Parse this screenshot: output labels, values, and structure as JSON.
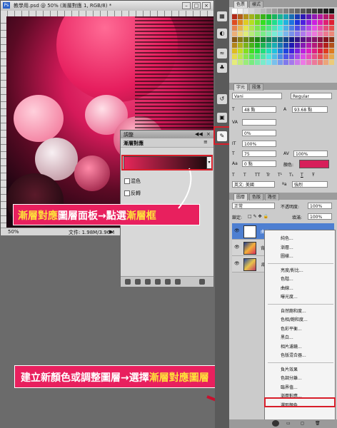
{
  "document": {
    "title": "教學用.psd @ 50% (漸層對應 1, RGB/8) *",
    "zoom": "50%",
    "file_info": "文件: 1.98M/3.96M"
  },
  "adjustments_panel": {
    "tab": "調整",
    "title": "漸層對應",
    "options": [
      "混色",
      "反轉"
    ]
  },
  "callouts": {
    "top_parts": [
      "漸層對應",
      "圖層面板→點選",
      "漸層框"
    ],
    "bottom_parts": [
      "建立新顏色或調整圖層→選擇",
      "漸層對應圖層"
    ]
  },
  "swatches_panel": {
    "tabs": [
      "色票",
      "樣式"
    ]
  },
  "character_panel": {
    "tabs": [
      "字元",
      "段落"
    ],
    "font_family": "Vani",
    "font_style": "Regular",
    "font_size": "48 點",
    "leading": "93.68 點",
    "kerning": "0%",
    "tracking": "100%",
    "horizontal_scale": "75",
    "vertical_scale": "100%",
    "baseline": "0 點",
    "color_label": "顏色:",
    "language": "英文: 美國",
    "antialias": "強烈",
    "style_buttons": [
      "T",
      "T",
      "TT",
      "Tr",
      "T¹",
      "T₁",
      "T",
      "Ŧ"
    ]
  },
  "layers_panel": {
    "tabs": [
      "圖層",
      "色版",
      "路徑"
    ],
    "blend_mode": "正常",
    "opacity_label": "不透明度:",
    "opacity": "100%",
    "lock_label": "鎖定:",
    "fill_label": "填滿:",
    "fill": "100%",
    "layers": [
      {
        "name": "曲線 1",
        "selected": true
      },
      {
        "name": "背景",
        "selected": false
      },
      {
        "name": "背景",
        "selected": false
      }
    ]
  },
  "adjustment_menu": {
    "groups": [
      [
        "純色...",
        "漸層...",
        "圖樣..."
      ],
      [
        "亮度/對比...",
        "色階...",
        "曲線...",
        "曝光度..."
      ],
      [
        "自然飽和度...",
        "色相/飽和度...",
        "色彩平衡...",
        "黑白...",
        "相片濾鏡...",
        "色版混合器..."
      ],
      [
        "負片效果",
        "色調分離...",
        "臨界值...",
        "漸層對應...",
        "選取顏色..."
      ]
    ]
  },
  "colors": {
    "accent": "#e8205e",
    "highlight": "#d81e2a",
    "callout_emphasis": "#ffe23a",
    "text_color_swatch": "#d71f5a"
  }
}
